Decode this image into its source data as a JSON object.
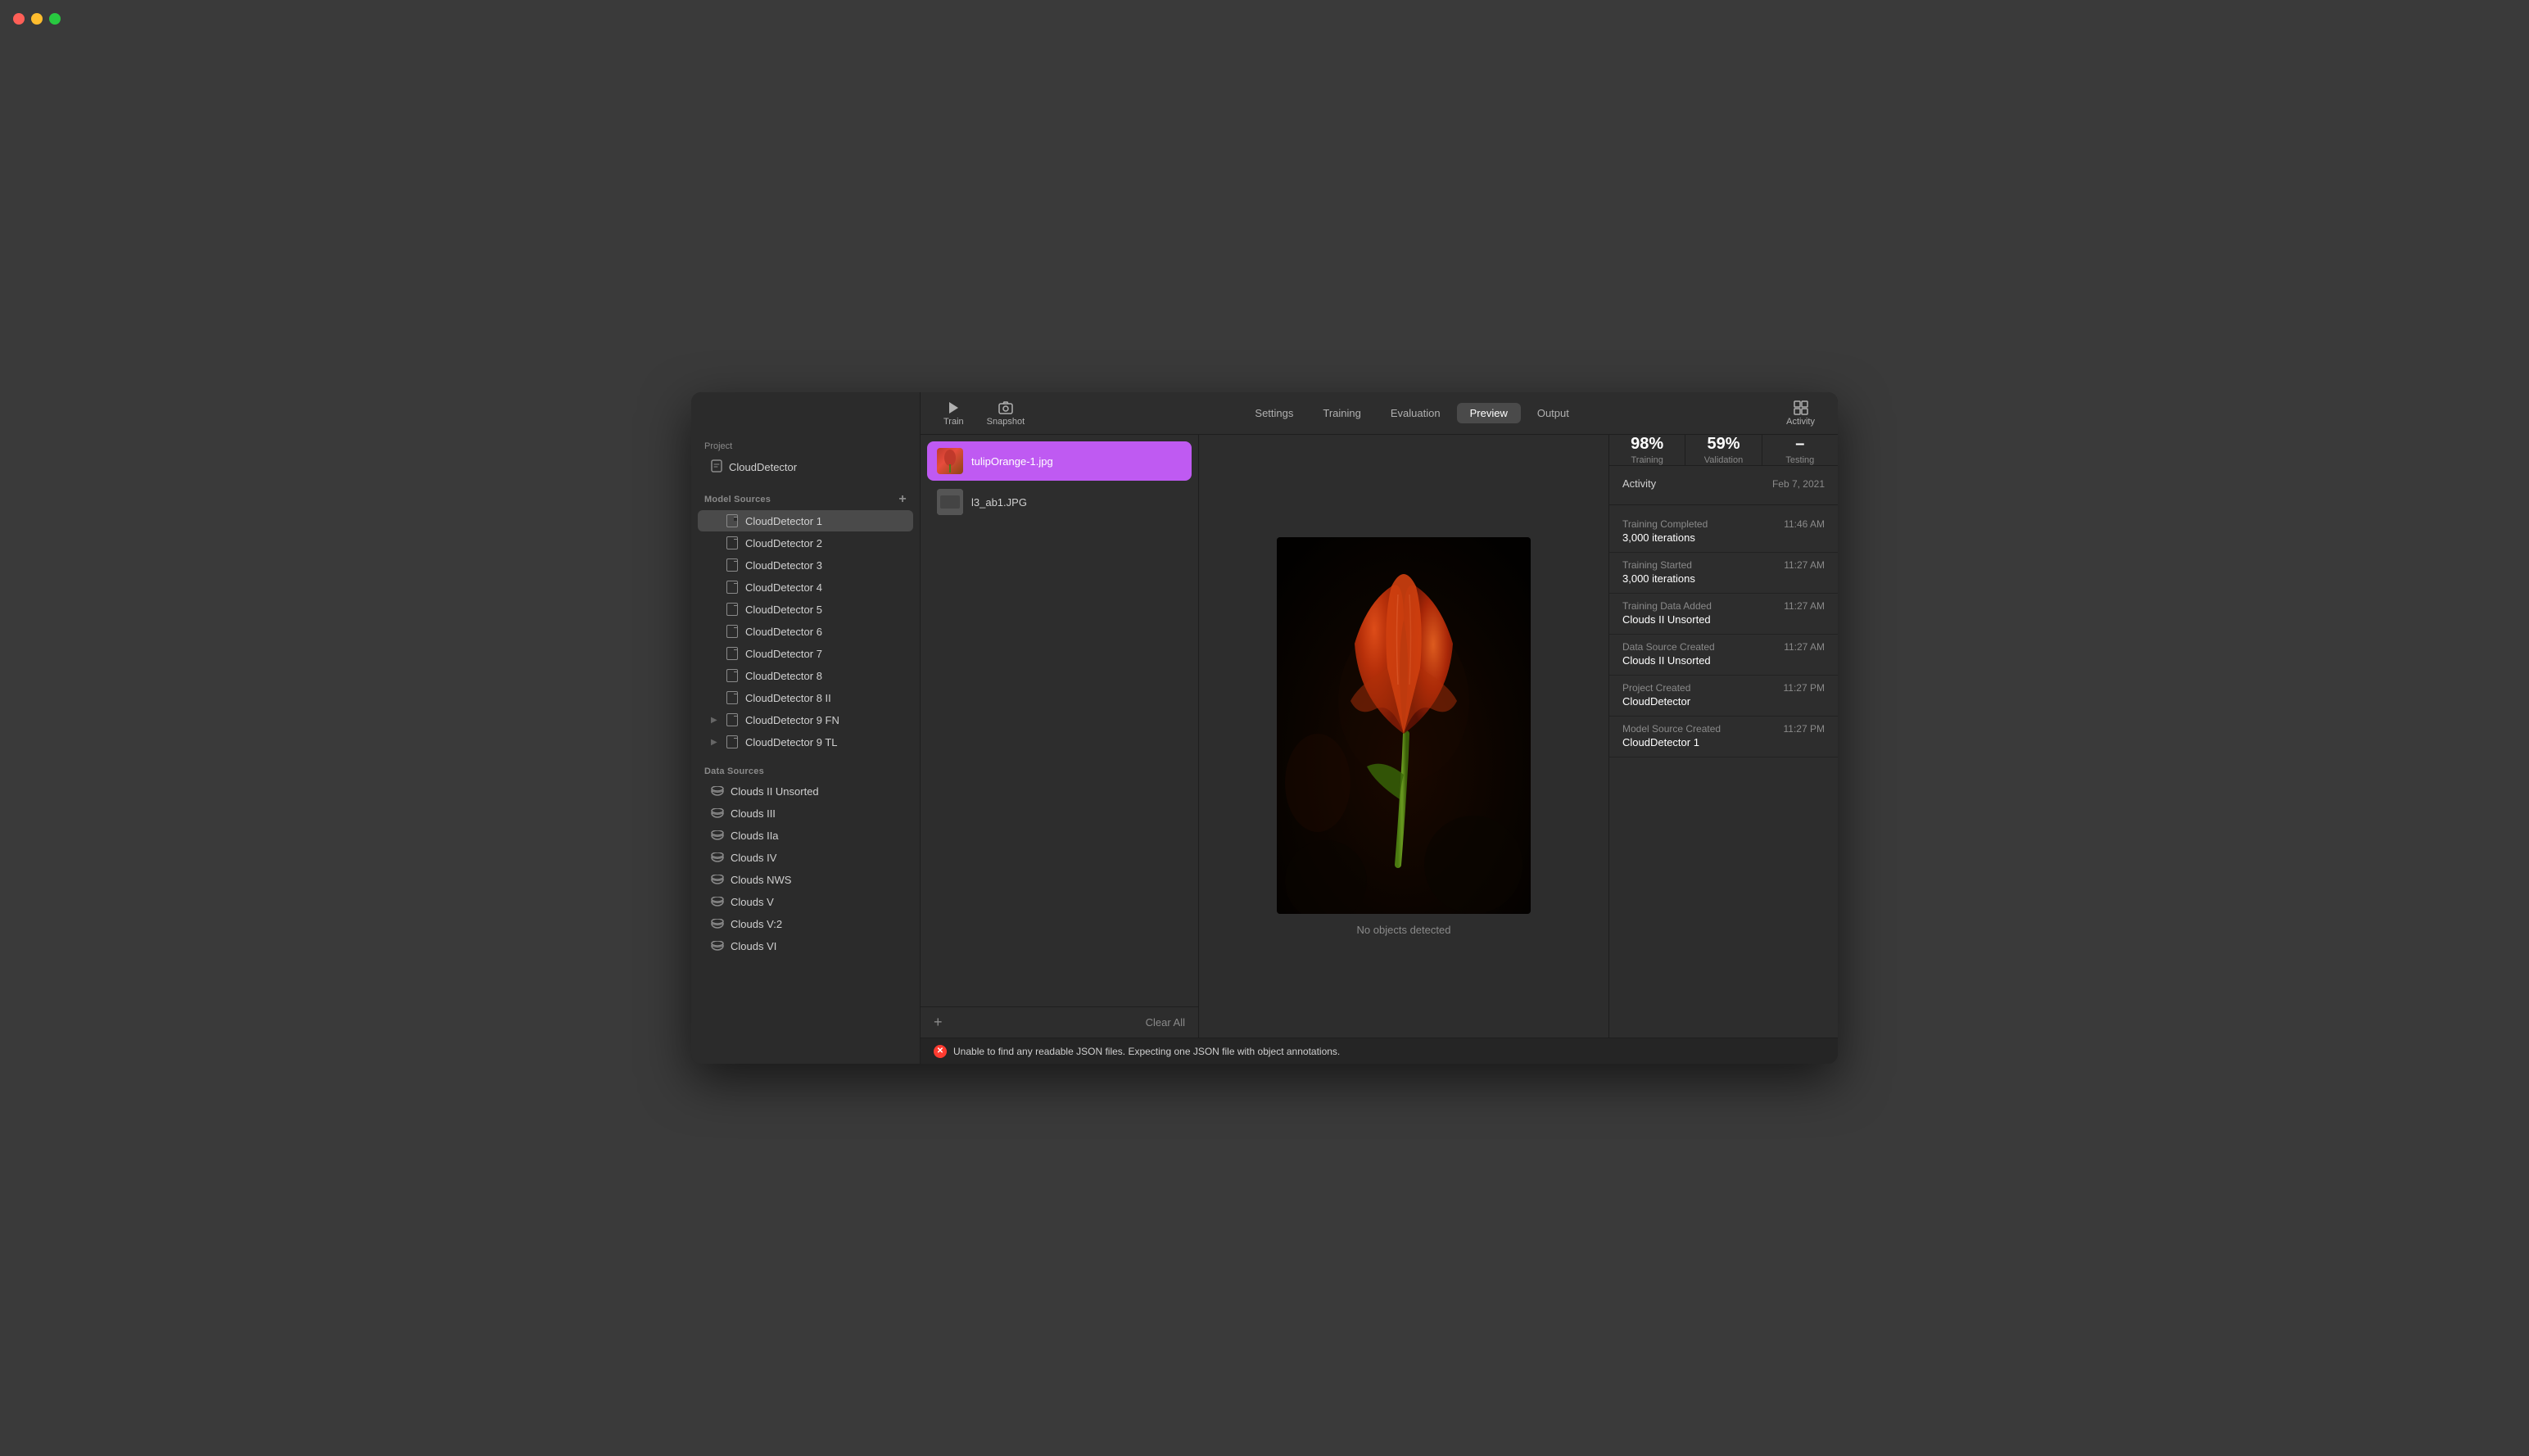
{
  "window": {
    "title": "CloudDetector"
  },
  "traffic_lights": {
    "close": "close",
    "minimize": "minimize",
    "maximize": "maximize"
  },
  "sidebar": {
    "project_label": "Project",
    "project_item": "CloudDetector",
    "model_sources_label": "Model Sources",
    "add_label": "+",
    "model_sources": [
      {
        "name": "CloudDetector 1",
        "active": true
      },
      {
        "name": "CloudDetector 2"
      },
      {
        "name": "CloudDetector 3"
      },
      {
        "name": "CloudDetector 4"
      },
      {
        "name": "CloudDetector 5"
      },
      {
        "name": "CloudDetector 6"
      },
      {
        "name": "CloudDetector 7"
      },
      {
        "name": "CloudDetector 8"
      },
      {
        "name": "CloudDetector 8 II"
      },
      {
        "name": "CloudDetector 9 FN",
        "expandable": true
      },
      {
        "name": "CloudDetector 9 TL",
        "expandable": true
      }
    ],
    "data_sources_label": "Data Sources",
    "data_sources": [
      {
        "name": "Clouds II Unsorted"
      },
      {
        "name": "Clouds III"
      },
      {
        "name": "Clouds IIa"
      },
      {
        "name": "Clouds IV"
      },
      {
        "name": "Clouds NWS"
      },
      {
        "name": "Clouds V"
      },
      {
        "name": "Clouds V:2"
      },
      {
        "name": "Clouds VI"
      }
    ]
  },
  "toolbar": {
    "train_label": "Train",
    "snapshot_label": "Snapshot",
    "tabs": [
      {
        "label": "Settings"
      },
      {
        "label": "Training"
      },
      {
        "label": "Evaluation"
      },
      {
        "label": "Preview",
        "active": true
      },
      {
        "label": "Output"
      }
    ],
    "activity_label": "Activity"
  },
  "stats": {
    "training_value": "98%",
    "training_label": "Training",
    "validation_value": "59%",
    "validation_label": "Validation",
    "testing_value": "–",
    "testing_label": "Testing"
  },
  "activity": {
    "title": "Activity",
    "date": "Feb 7, 2021",
    "entries": [
      {
        "label": "Training Completed",
        "time": "11:46 AM",
        "value": "3,000 iterations"
      },
      {
        "label": "Training Started",
        "time": "11:27 AM",
        "value": "3,000 iterations"
      },
      {
        "label": "Training Data Added",
        "time": "11:27 AM",
        "value": "Clouds II Unsorted"
      },
      {
        "label": "Data Source Created",
        "time": "11:27 AM",
        "value": "Clouds II Unsorted"
      },
      {
        "label": "Project Created",
        "time": "11:27 PM",
        "value": "CloudDetector"
      },
      {
        "label": "Model Source Created",
        "time": "11:27 PM",
        "value": "CloudDetector 1"
      }
    ]
  },
  "file_panel": {
    "files": [
      {
        "name": "tulipOrange-1.jpg",
        "selected": true,
        "type": "tulip"
      },
      {
        "name": "l3_ab1.JPG",
        "selected": false,
        "type": "gray"
      }
    ],
    "add_label": "+",
    "clear_label": "Clear All"
  },
  "preview": {
    "status": "No objects detected"
  },
  "status_bar": {
    "error_message": "Unable to find any readable JSON files. Expecting one JSON file with object annotations."
  }
}
